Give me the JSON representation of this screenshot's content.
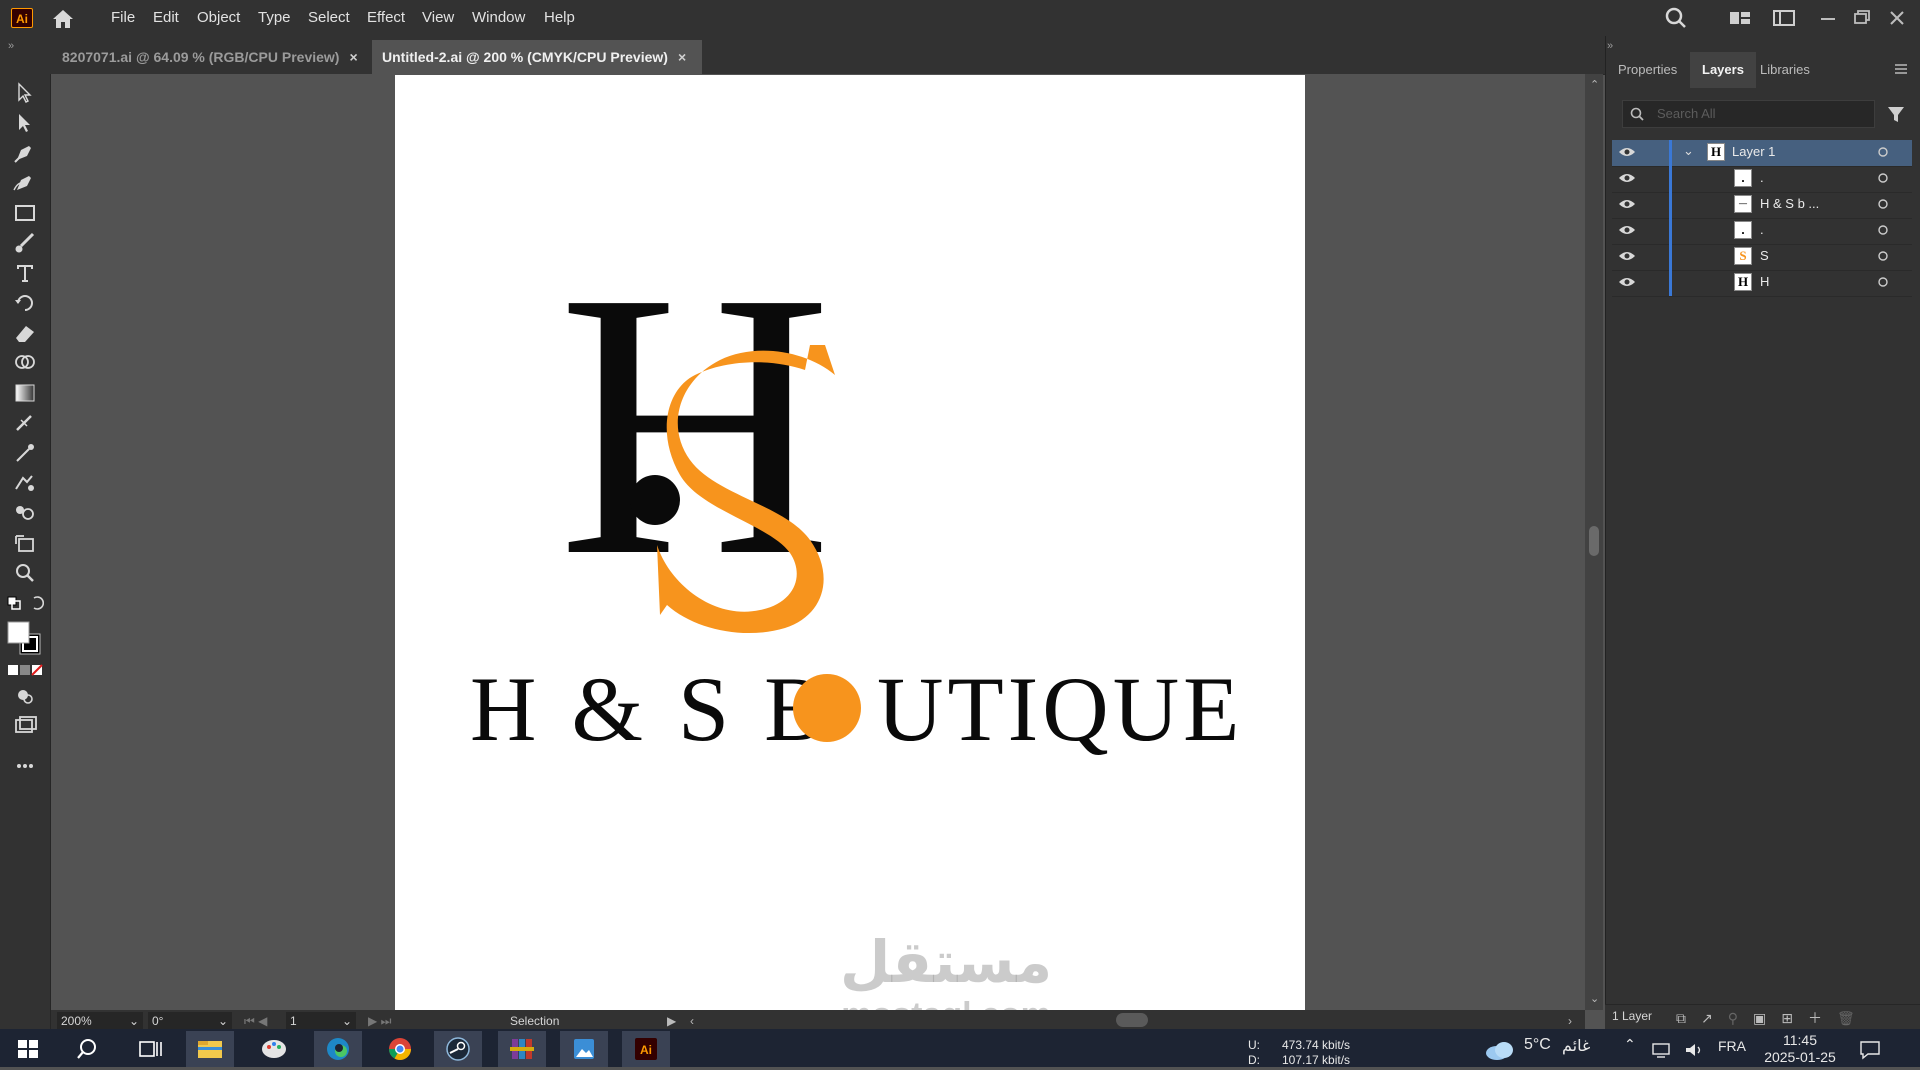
{
  "app": {
    "logo": "Ai"
  },
  "menu": [
    "File",
    "Edit",
    "Object",
    "Type",
    "Select",
    "Effect",
    "View",
    "Window",
    "Help"
  ],
  "tabs": [
    {
      "label": "8207071.ai @ 64.09 % (RGB/CPU Preview)",
      "close": "×"
    },
    {
      "label": "Untitled-2.ai @ 200 % (CMYK/CPU Preview)",
      "close": "×"
    }
  ],
  "artwork": {
    "monogram_h": "H",
    "wordmark_parts": [
      "H & S B",
      "UTIQUE"
    ],
    "colors": {
      "orange": "#f7941d",
      "black": "#0a0a0a"
    }
  },
  "status": {
    "zoom": "200%",
    "rotation": "0°",
    "artboard": "1",
    "tool": "Selection"
  },
  "panel": {
    "tabs": [
      "Properties",
      "Layers",
      "Libraries"
    ],
    "search_placeholder": "Search All",
    "layers": [
      {
        "name": "Layer 1",
        "thumb": "H",
        "selected": true
      },
      {
        "name": ".",
        "thumb": "."
      },
      {
        "name": "H & S b  ...",
        "thumb": "—"
      },
      {
        "name": ".",
        "thumb": "."
      },
      {
        "name": "S",
        "thumb": "S"
      },
      {
        "name": "H",
        "thumb": "H"
      }
    ],
    "footer_label": "1 Layer"
  },
  "taskbar": {
    "net_up_label": "U:",
    "net_up": "473.74 kbit/s",
    "net_down_label": "D:",
    "net_down": "107.17 kbit/s",
    "weather_temp": "5°C",
    "weather_text": "غائم",
    "lang": "FRA",
    "time": "11:45",
    "date": "2025-01-25"
  },
  "watermark": {
    "arabic": "مستقل",
    "latin": "mostaql.com"
  }
}
